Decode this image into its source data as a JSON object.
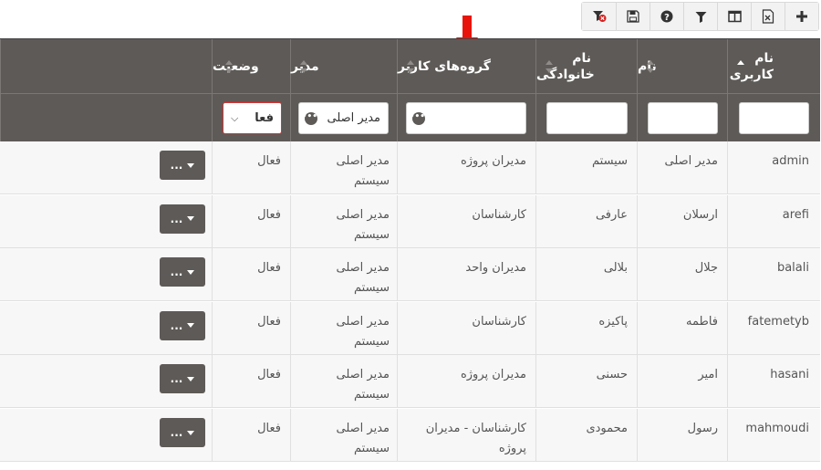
{
  "toolbar": {
    "buttons": [
      {
        "icon": "plus-icon"
      },
      {
        "icon": "excel-export-icon"
      },
      {
        "icon": "columns-icon"
      },
      {
        "icon": "filter-icon"
      },
      {
        "icon": "help-icon"
      },
      {
        "icon": "save-icon"
      },
      {
        "icon": "clear-filter-icon"
      }
    ]
  },
  "table": {
    "headers": {
      "username": "نام کاربری",
      "first_name": "نام",
      "last_name": "نام خانوادگی",
      "groups": "گروه‌های کاربر",
      "manager": "مدیر",
      "status": "وضعیت"
    },
    "filters": {
      "manager_value": "مدیر اصلی",
      "status_value": "فعا",
      "dots": "•••"
    },
    "rows": [
      {
        "username": "admin",
        "first_name": "مدیر اصلی",
        "last_name": "سیستم",
        "groups": "مدیران پروژه",
        "manager": "مدیر اصلی سیستم",
        "status": "فعال",
        "action": "..."
      },
      {
        "username": "arefi",
        "first_name": "ارسلان",
        "last_name": "عارفی",
        "groups": "کارشناسان",
        "manager": "مدیر اصلی سیستم",
        "status": "فعال",
        "action": "..."
      },
      {
        "username": "balali",
        "first_name": "جلال",
        "last_name": "بلالی",
        "groups": "مدیران واحد",
        "manager": "مدیر اصلی سیستم",
        "status": "فعال",
        "action": "..."
      },
      {
        "username": "fatemetyb",
        "first_name": "فاطمه",
        "last_name": "پاکیزه",
        "groups": "کارشناسان",
        "manager": "مدیر اصلی سیستم",
        "status": "فعال",
        "action": "..."
      },
      {
        "username": "hasani",
        "first_name": "امیر",
        "last_name": "حسنی",
        "groups": "مدیران پروژه",
        "manager": "مدیر اصلی سیستم",
        "status": "فعال",
        "action": "..."
      },
      {
        "username": "mahmoudi",
        "first_name": "رسول",
        "last_name": "محمودی",
        "groups": "کارشناسان - مدیران پروژه",
        "manager": "مدیر اصلی سیستم",
        "status": "فعال",
        "action": "..."
      }
    ]
  },
  "colors": {
    "header_bg": "#5d5a57",
    "row_bg": "#f7f7f7",
    "arrow": "#e8140c",
    "status_border": "#e03030"
  }
}
